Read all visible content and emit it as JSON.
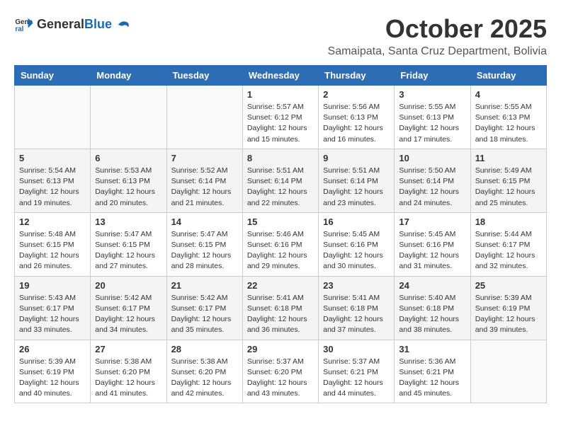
{
  "header": {
    "logo_general": "General",
    "logo_blue": "Blue",
    "month_title": "October 2025",
    "location": "Samaipata, Santa Cruz Department, Bolivia"
  },
  "calendar": {
    "days_of_week": [
      "Sunday",
      "Monday",
      "Tuesday",
      "Wednesday",
      "Thursday",
      "Friday",
      "Saturday"
    ],
    "weeks": [
      [
        {
          "day": "",
          "info": ""
        },
        {
          "day": "",
          "info": ""
        },
        {
          "day": "",
          "info": ""
        },
        {
          "day": "1",
          "info": "Sunrise: 5:57 AM\nSunset: 6:12 PM\nDaylight: 12 hours\nand 15 minutes."
        },
        {
          "day": "2",
          "info": "Sunrise: 5:56 AM\nSunset: 6:13 PM\nDaylight: 12 hours\nand 16 minutes."
        },
        {
          "day": "3",
          "info": "Sunrise: 5:55 AM\nSunset: 6:13 PM\nDaylight: 12 hours\nand 17 minutes."
        },
        {
          "day": "4",
          "info": "Sunrise: 5:55 AM\nSunset: 6:13 PM\nDaylight: 12 hours\nand 18 minutes."
        }
      ],
      [
        {
          "day": "5",
          "info": "Sunrise: 5:54 AM\nSunset: 6:13 PM\nDaylight: 12 hours\nand 19 minutes."
        },
        {
          "day": "6",
          "info": "Sunrise: 5:53 AM\nSunset: 6:13 PM\nDaylight: 12 hours\nand 20 minutes."
        },
        {
          "day": "7",
          "info": "Sunrise: 5:52 AM\nSunset: 6:14 PM\nDaylight: 12 hours\nand 21 minutes."
        },
        {
          "day": "8",
          "info": "Sunrise: 5:51 AM\nSunset: 6:14 PM\nDaylight: 12 hours\nand 22 minutes."
        },
        {
          "day": "9",
          "info": "Sunrise: 5:51 AM\nSunset: 6:14 PM\nDaylight: 12 hours\nand 23 minutes."
        },
        {
          "day": "10",
          "info": "Sunrise: 5:50 AM\nSunset: 6:14 PM\nDaylight: 12 hours\nand 24 minutes."
        },
        {
          "day": "11",
          "info": "Sunrise: 5:49 AM\nSunset: 6:15 PM\nDaylight: 12 hours\nand 25 minutes."
        }
      ],
      [
        {
          "day": "12",
          "info": "Sunrise: 5:48 AM\nSunset: 6:15 PM\nDaylight: 12 hours\nand 26 minutes."
        },
        {
          "day": "13",
          "info": "Sunrise: 5:47 AM\nSunset: 6:15 PM\nDaylight: 12 hours\nand 27 minutes."
        },
        {
          "day": "14",
          "info": "Sunrise: 5:47 AM\nSunset: 6:15 PM\nDaylight: 12 hours\nand 28 minutes."
        },
        {
          "day": "15",
          "info": "Sunrise: 5:46 AM\nSunset: 6:16 PM\nDaylight: 12 hours\nand 29 minutes."
        },
        {
          "day": "16",
          "info": "Sunrise: 5:45 AM\nSunset: 6:16 PM\nDaylight: 12 hours\nand 30 minutes."
        },
        {
          "day": "17",
          "info": "Sunrise: 5:45 AM\nSunset: 6:16 PM\nDaylight: 12 hours\nand 31 minutes."
        },
        {
          "day": "18",
          "info": "Sunrise: 5:44 AM\nSunset: 6:17 PM\nDaylight: 12 hours\nand 32 minutes."
        }
      ],
      [
        {
          "day": "19",
          "info": "Sunrise: 5:43 AM\nSunset: 6:17 PM\nDaylight: 12 hours\nand 33 minutes."
        },
        {
          "day": "20",
          "info": "Sunrise: 5:42 AM\nSunset: 6:17 PM\nDaylight: 12 hours\nand 34 minutes."
        },
        {
          "day": "21",
          "info": "Sunrise: 5:42 AM\nSunset: 6:17 PM\nDaylight: 12 hours\nand 35 minutes."
        },
        {
          "day": "22",
          "info": "Sunrise: 5:41 AM\nSunset: 6:18 PM\nDaylight: 12 hours\nand 36 minutes."
        },
        {
          "day": "23",
          "info": "Sunrise: 5:41 AM\nSunset: 6:18 PM\nDaylight: 12 hours\nand 37 minutes."
        },
        {
          "day": "24",
          "info": "Sunrise: 5:40 AM\nSunset: 6:18 PM\nDaylight: 12 hours\nand 38 minutes."
        },
        {
          "day": "25",
          "info": "Sunrise: 5:39 AM\nSunset: 6:19 PM\nDaylight: 12 hours\nand 39 minutes."
        }
      ],
      [
        {
          "day": "26",
          "info": "Sunrise: 5:39 AM\nSunset: 6:19 PM\nDaylight: 12 hours\nand 40 minutes."
        },
        {
          "day": "27",
          "info": "Sunrise: 5:38 AM\nSunset: 6:20 PM\nDaylight: 12 hours\nand 41 minutes."
        },
        {
          "day": "28",
          "info": "Sunrise: 5:38 AM\nSunset: 6:20 PM\nDaylight: 12 hours\nand 42 minutes."
        },
        {
          "day": "29",
          "info": "Sunrise: 5:37 AM\nSunset: 6:20 PM\nDaylight: 12 hours\nand 43 minutes."
        },
        {
          "day": "30",
          "info": "Sunrise: 5:37 AM\nSunset: 6:21 PM\nDaylight: 12 hours\nand 44 minutes."
        },
        {
          "day": "31",
          "info": "Sunrise: 5:36 AM\nSunset: 6:21 PM\nDaylight: 12 hours\nand 45 minutes."
        },
        {
          "day": "",
          "info": ""
        }
      ]
    ]
  }
}
